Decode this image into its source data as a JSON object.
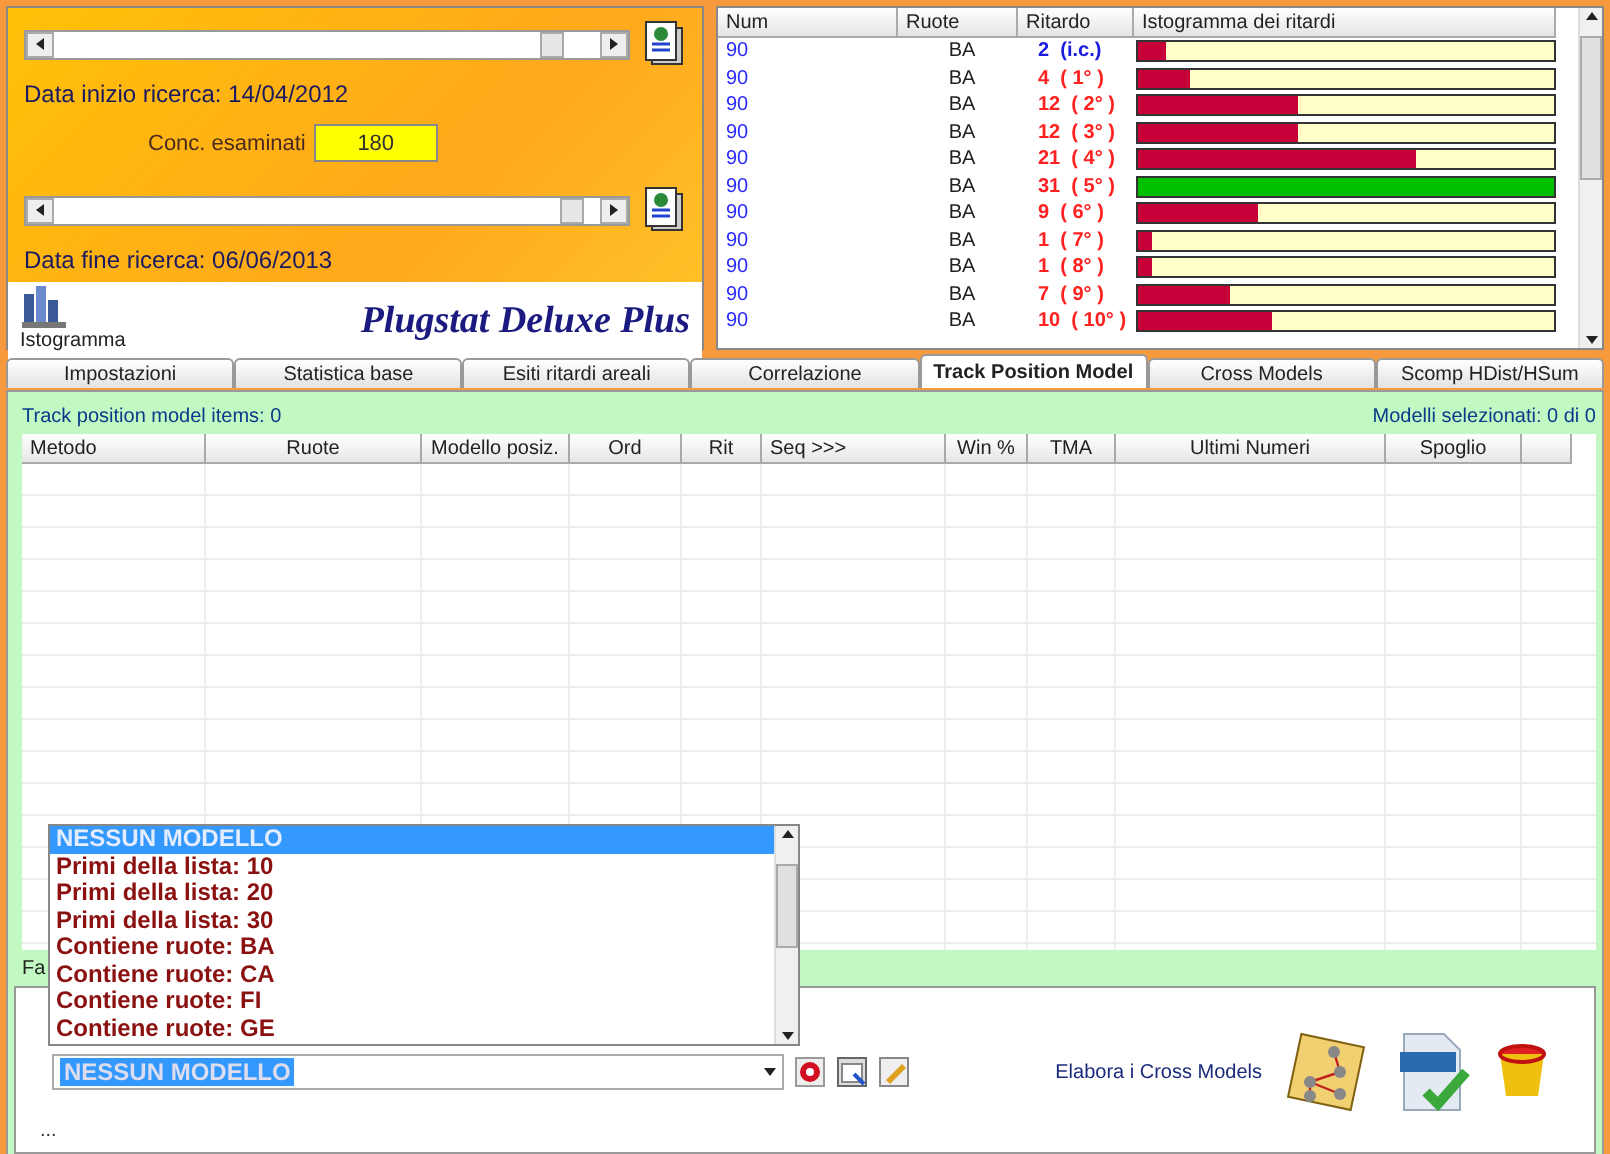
{
  "search_panel": {
    "start_slider": {
      "level": 0.93
    },
    "start_label": "Data inizio ricerca: 14/04/2012",
    "count_label": "Conc. esaminati",
    "count_value": "180",
    "end_slider": {
      "level": 0.97
    },
    "end_label": "Data fine ricerca: 06/06/2013",
    "histogram_button": "Istogramma",
    "app_title": "Plugstat Deluxe Plus"
  },
  "delay_table": {
    "columns": [
      "Num",
      "Ruote",
      "Ritardo",
      "Istogramma dei ritardi"
    ],
    "rows": [
      {
        "num": "90",
        "ruote": "BA",
        "ritardo": "2",
        "rank": "(i.c.)",
        "kind": "current",
        "level": 0.065,
        "color": "#c8003a"
      },
      {
        "num": "90",
        "ruote": "BA",
        "ritardo": "4",
        "rank": "( 1° )",
        "kind": "past",
        "level": 0.125,
        "color": "#c8003a"
      },
      {
        "num": "90",
        "ruote": "BA",
        "ritardo": "12",
        "rank": "( 2° )",
        "kind": "past",
        "level": 0.385,
        "color": "#c8003a"
      },
      {
        "num": "90",
        "ruote": "BA",
        "ritardo": "12",
        "rank": "( 3° )",
        "kind": "past",
        "level": 0.385,
        "color": "#c8003a"
      },
      {
        "num": "90",
        "ruote": "BA",
        "ritardo": "21",
        "rank": "( 4° )",
        "kind": "past",
        "level": 0.67,
        "color": "#c8003a"
      },
      {
        "num": "90",
        "ruote": "BA",
        "ritardo": "31",
        "rank": "( 5° )",
        "kind": "past",
        "level": 1,
        "color": "#00c000"
      },
      {
        "num": "90",
        "ruote": "BA",
        "ritardo": "9",
        "rank": "( 6° )",
        "kind": "past",
        "level": 0.29,
        "color": "#c8003a"
      },
      {
        "num": "90",
        "ruote": "BA",
        "ritardo": "1",
        "rank": "( 7° )",
        "kind": "past",
        "level": 0.032,
        "color": "#c8003a"
      },
      {
        "num": "90",
        "ruote": "BA",
        "ritardo": "1",
        "rank": "( 8° )",
        "kind": "past",
        "level": 0.032,
        "color": "#c8003a"
      },
      {
        "num": "90",
        "ruote": "BA",
        "ritardo": "7",
        "rank": "( 9° )",
        "kind": "past",
        "level": 0.22,
        "color": "#c8003a"
      },
      {
        "num": "90",
        "ruote": "BA",
        "ritardo": "10",
        "rank": "( 10° )",
        "kind": "past",
        "level": 0.32,
        "color": "#c8003a"
      }
    ]
  },
  "tabs": [
    {
      "label": "Impostazioni",
      "selected": false
    },
    {
      "label": "Statistica base",
      "selected": false
    },
    {
      "label": "Esiti ritardi areali",
      "selected": false
    },
    {
      "label": "Correlazione",
      "selected": false
    },
    {
      "label": "Track Position Model",
      "selected": true
    },
    {
      "label": "Cross Models",
      "selected": false
    },
    {
      "label": "Scomp HDist/HSum",
      "selected": false
    }
  ],
  "status_left": "Track position model items: 0",
  "status_right": "Modelli selezionati: 0 di 0",
  "grid": {
    "columns": [
      "Metodo",
      "Ruote",
      "Modello posiz.",
      "Ord",
      "Rit",
      "Seq >>>",
      "Win %",
      "TMA",
      "Ultimi Numeri",
      "Spoglio"
    ]
  },
  "filter_label": "Fa",
  "model_list": {
    "items": [
      {
        "label": "NESSUN MODELLO",
        "selected": true
      },
      {
        "label": "Primi della lista: 10",
        "selected": false
      },
      {
        "label": "Primi della lista: 20",
        "selected": false
      },
      {
        "label": "Primi della lista: 30",
        "selected": false
      },
      {
        "label": "Contiene ruote: BA",
        "selected": false
      },
      {
        "label": "Contiene ruote: CA",
        "selected": false
      },
      {
        "label": "Contiene ruote: FI",
        "selected": false
      },
      {
        "label": "Contiene ruote: GE",
        "selected": false
      }
    ]
  },
  "model_combo": {
    "value": "NESSUN MODELLO"
  },
  "cross_label": "Elabora i Cross Models",
  "ellipsis": "..."
}
